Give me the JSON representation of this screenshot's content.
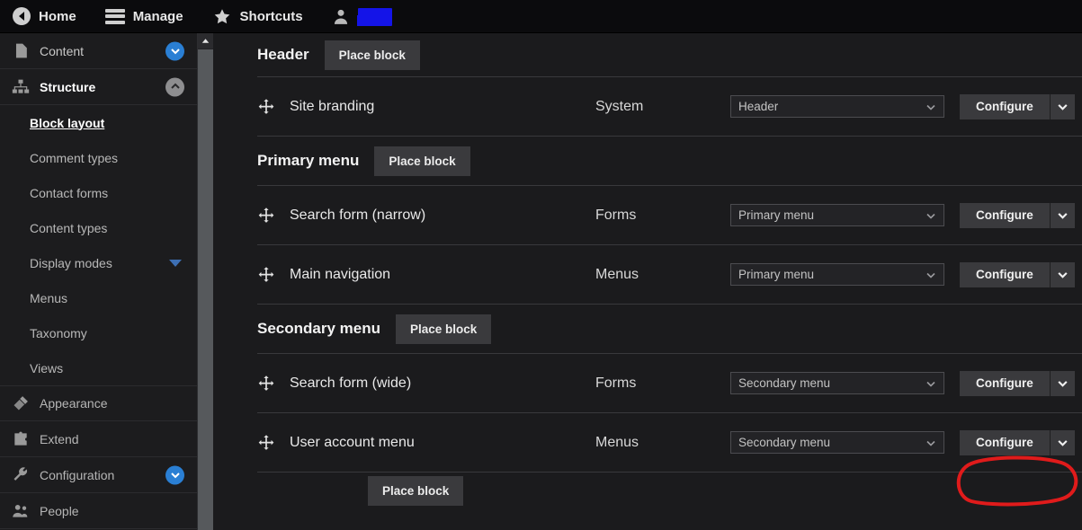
{
  "toolbar": {
    "items": [
      {
        "label": "Home",
        "icon": "home-back-icon"
      },
      {
        "label": "Manage",
        "icon": "hamburger-icon"
      },
      {
        "label": "Shortcuts",
        "icon": "star-icon"
      },
      {
        "label": "",
        "icon": "user-icon"
      }
    ],
    "user_name_redacted": ""
  },
  "sidebar": {
    "items": [
      {
        "label": "Content",
        "icon": "document-icon",
        "badge": "chevron-down",
        "badge_color": "#2a7fd4",
        "type": "top"
      },
      {
        "label": "Structure",
        "icon": "sitemap-icon",
        "badge": "chevron-up",
        "badge_color": "#8e8e90",
        "type": "top",
        "active": true
      },
      {
        "label": "Block layout",
        "type": "sub",
        "current": true
      },
      {
        "label": "Comment types",
        "type": "sub"
      },
      {
        "label": "Contact forms",
        "type": "sub"
      },
      {
        "label": "Content types",
        "type": "sub"
      },
      {
        "label": "Display modes",
        "type": "sub",
        "triangle": "chevron-down-blue"
      },
      {
        "label": "Menus",
        "type": "sub"
      },
      {
        "label": "Taxonomy",
        "type": "sub"
      },
      {
        "label": "Views",
        "type": "sub"
      },
      {
        "label": "Appearance",
        "icon": "paintbrush-icon",
        "type": "top"
      },
      {
        "label": "Extend",
        "icon": "puzzle-icon",
        "type": "top"
      },
      {
        "label": "Configuration",
        "icon": "wrench-icon",
        "badge": "chevron-down",
        "badge_color": "#2a7fd4",
        "type": "top"
      },
      {
        "label": "People",
        "icon": "people-icon",
        "type": "top"
      }
    ]
  },
  "main": {
    "place_block_label": "Place block",
    "configure_label": "Configure",
    "sections": [
      {
        "title": "Header",
        "rows": [
          {
            "name": "Site branding",
            "category": "System",
            "region": "Header"
          }
        ]
      },
      {
        "title": "Primary menu",
        "rows": [
          {
            "name": "Search form (narrow)",
            "category": "Forms",
            "region": "Primary menu"
          },
          {
            "name": "Main navigation",
            "category": "Menus",
            "region": "Primary menu"
          }
        ]
      },
      {
        "title": "Secondary menu",
        "rows": [
          {
            "name": "Search form (wide)",
            "category": "Forms",
            "region": "Secondary menu"
          },
          {
            "name": "User account menu",
            "category": "Menus",
            "region": "Secondary menu"
          }
        ]
      }
    ]
  },
  "annotation": {
    "shape": "red-ellipse",
    "color": "#e01b1b",
    "target": "configure-button-user-account-menu"
  }
}
